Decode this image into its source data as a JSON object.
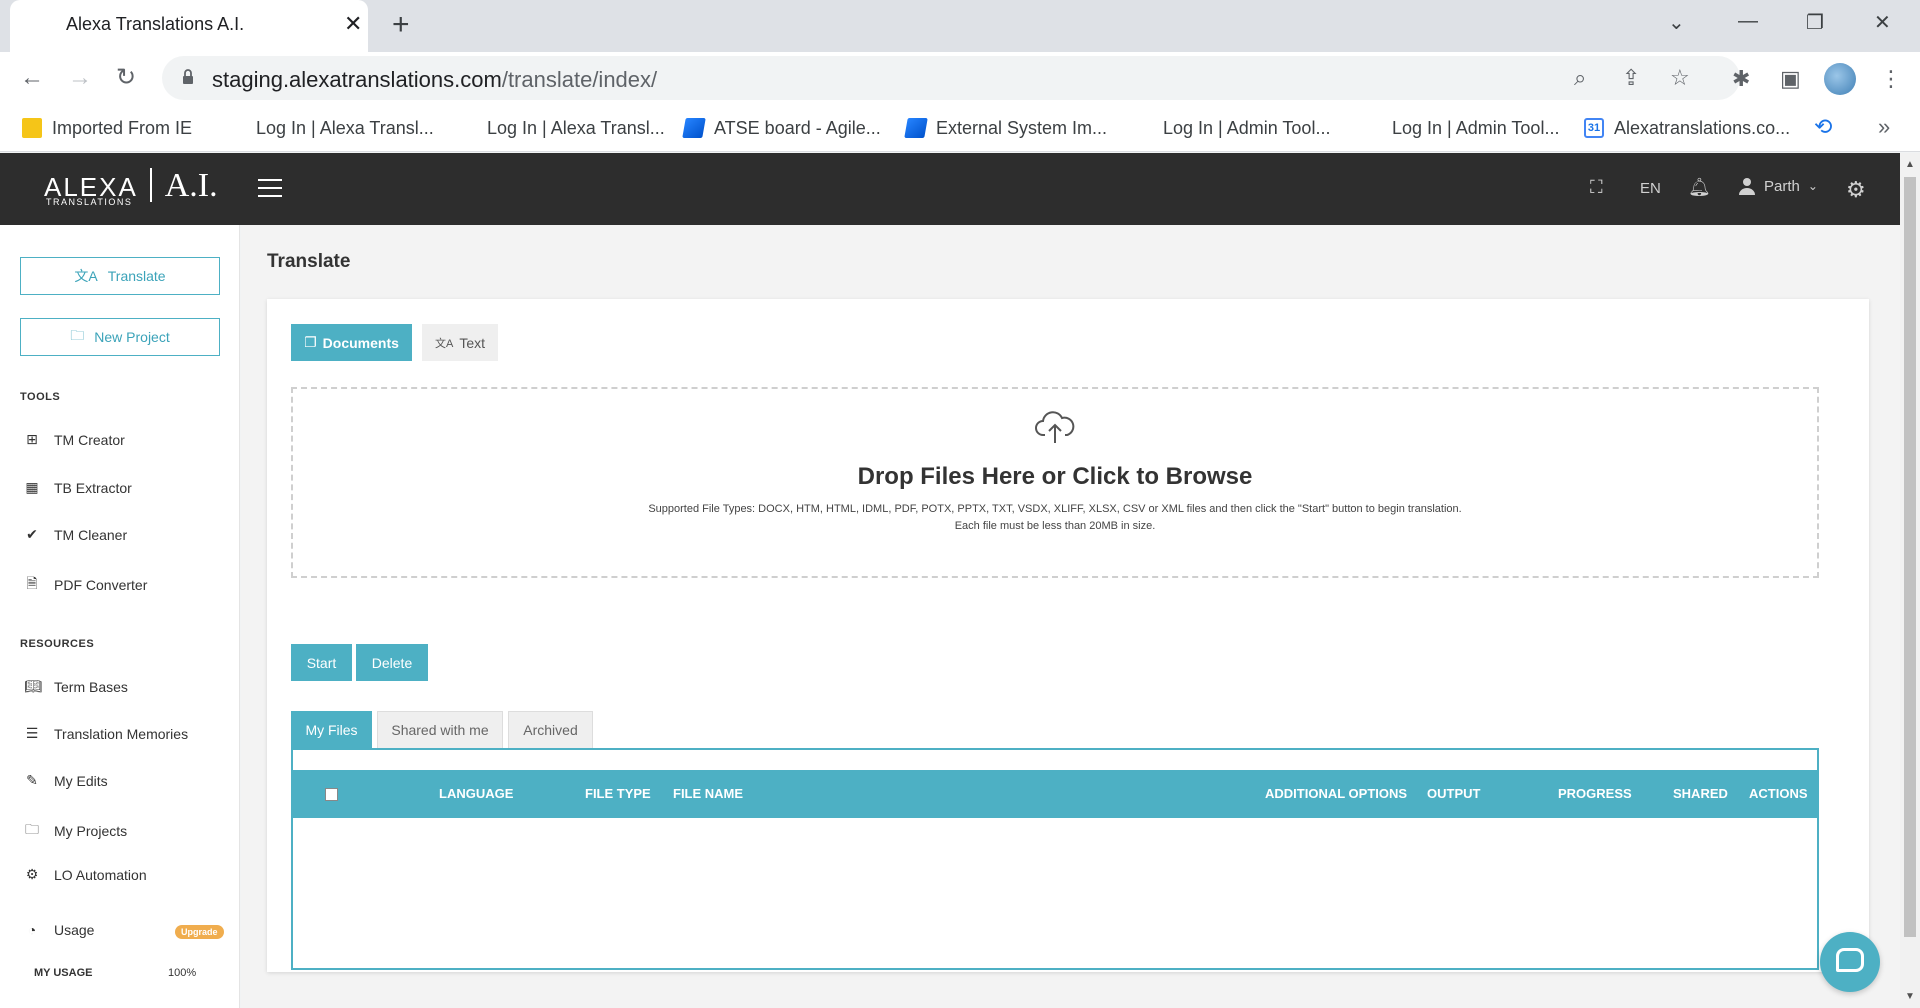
{
  "browser": {
    "tab_title": "Alexa Translations A.I.",
    "url_host": "staging.alexatranslations.com",
    "url_path": "/translate/index/",
    "bookmarks": [
      {
        "label": "Imported From IE",
        "icon": "folder-icon"
      },
      {
        "label": "Log In | Alexa Transl...",
        "icon": "none"
      },
      {
        "label": "Log In | Alexa Transl...",
        "icon": "none"
      },
      {
        "label": "ATSE board - Agile...",
        "icon": "jira-icon"
      },
      {
        "label": "External System Im...",
        "icon": "jira-icon"
      },
      {
        "label": "Log In | Admin Tool...",
        "icon": "none"
      },
      {
        "label": "Log In | Admin Tool...",
        "icon": "none"
      },
      {
        "label": "Alexatranslations.co...",
        "icon": "calendar-icon"
      }
    ],
    "calendar_day": "31"
  },
  "header": {
    "logo_text": "ALEXA",
    "logo_sub": "TRANSLATIONS",
    "logo_ai": "A.I.",
    "lang": "EN",
    "user_name": "Parth"
  },
  "sidebar": {
    "translate_label": "Translate",
    "new_project_label": "New Project",
    "tools_heading": "TOOLS",
    "tools": [
      {
        "label": "TM Creator",
        "icon": "table-icon"
      },
      {
        "label": "TB Extractor",
        "icon": "grid-icon"
      },
      {
        "label": "TM Cleaner",
        "icon": "broom-icon"
      },
      {
        "label": "PDF Converter",
        "icon": "file-icon"
      }
    ],
    "resources_heading": "RESOURCES",
    "resources": [
      {
        "label": "Term Bases",
        "icon": "book-icon"
      },
      {
        "label": "Translation Memories",
        "icon": "list-icon"
      },
      {
        "label": "My Edits",
        "icon": "user-edit-icon"
      },
      {
        "label": "My Projects",
        "icon": "folder-icon"
      },
      {
        "label": "LO Automation",
        "icon": "robot-icon"
      }
    ],
    "usage_label": "Usage",
    "upgrade_badge": "Upgrade",
    "my_usage_label": "MY USAGE",
    "my_usage_value": "100%"
  },
  "main": {
    "page_title": "Translate",
    "documents_label": "Documents",
    "text_label": "Text",
    "dropzone_title": "Drop Files Here or Click to Browse",
    "dropzone_line1": "Supported File Types: DOCX, HTM, HTML, IDML, PDF, POTX, PPTX, TXT, VSDX, XLIFF, XLSX, CSV or XML files and then click the \"Start\" button to begin translation.",
    "dropzone_line2": "Each file must be less than 20MB in size.",
    "start_label": "Start",
    "delete_label": "Delete",
    "file_tabs": [
      "My Files",
      "Shared with me",
      "Archived"
    ],
    "table_headers": [
      "LANGUAGE",
      "FILE TYPE",
      "FILE NAME",
      "ADDITIONAL OPTIONS",
      "OUTPUT",
      "PROGRESS",
      "SHARED",
      "ACTIONS"
    ]
  },
  "colors": {
    "accent": "#4db0c4",
    "header_bg": "#2d2d2d",
    "upgrade": "#f0ad4e"
  }
}
